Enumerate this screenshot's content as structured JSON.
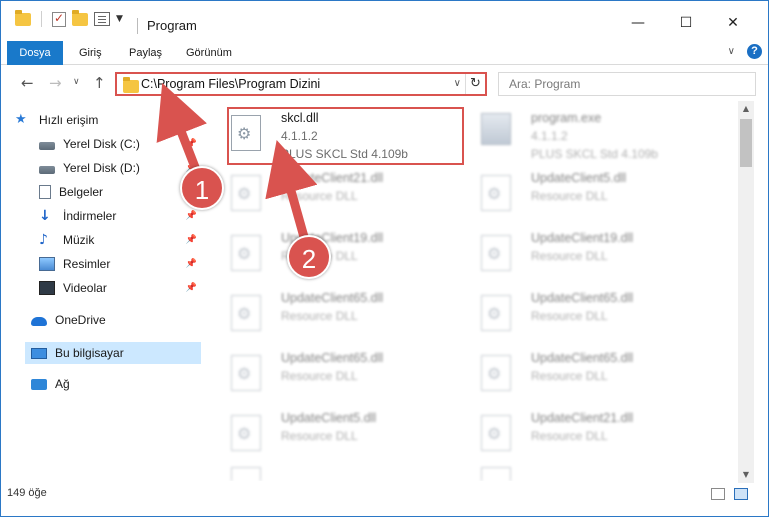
{
  "window": {
    "title": "Program"
  },
  "ribbon": {
    "tabs": [
      "Dosya",
      "Giriş",
      "Paylaş",
      "Görünüm"
    ]
  },
  "navigation": {
    "address": "C:\\Program Files\\Program Dizini",
    "search_placeholder": "Ara: Program"
  },
  "sidebar": {
    "items": [
      {
        "label": "Hızlı erişim",
        "icon": "star-icon"
      },
      {
        "label": "Yerel Disk (C:)",
        "icon": "drive-icon",
        "pinned": true
      },
      {
        "label": "Yerel Disk (D:)",
        "icon": "drive-icon",
        "pinned": true
      },
      {
        "label": "Belgeler",
        "icon": "document-icon",
        "pinned": true
      },
      {
        "label": "İndirmeler",
        "icon": "download-icon",
        "pinned": true
      },
      {
        "label": "Müzik",
        "icon": "music-icon",
        "pinned": true
      },
      {
        "label": "Resimler",
        "icon": "pictures-icon",
        "pinned": true
      },
      {
        "label": "Videolar",
        "icon": "video-icon",
        "pinned": true
      },
      {
        "label": "OneDrive",
        "icon": "cloud-icon"
      },
      {
        "label": "Bu bilgisayar",
        "icon": "computer-icon",
        "selected": true
      },
      {
        "label": "Ağ",
        "icon": "network-icon"
      }
    ]
  },
  "files": [
    {
      "name": "skcl.dll",
      "line2": "4.1.1.2",
      "line3": "PLUS SKCL Std 4.109b",
      "highlighted": true
    },
    {
      "name": "program.exe",
      "line2": "4.1.1.2",
      "line3": "PLUS SKCL Std 4.109b"
    },
    {
      "name": "UpdateClient21.dll",
      "line2": "Resource DLL"
    },
    {
      "name": "UpdateClient5.dll",
      "line2": "Resource DLL"
    },
    {
      "name": "UpdateClient19.dll",
      "line2": "Resource DLL"
    },
    {
      "name": "UpdateClient19.dll",
      "line2": "Resource DLL"
    },
    {
      "name": "UpdateClient65.dll",
      "line2": "Resource DLL"
    },
    {
      "name": "UpdateClient65.dll",
      "line2": "Resource DLL"
    },
    {
      "name": "UpdateClient65.dll",
      "line2": "Resource DLL"
    },
    {
      "name": "UpdateClient65.dll",
      "line2": "Resource DLL"
    },
    {
      "name": "UpdateClient5.dll",
      "line2": "Resource DLL"
    },
    {
      "name": "UpdateClient21.dll",
      "line2": "Resource DLL"
    }
  ],
  "status": {
    "item_count": "149 öğe"
  },
  "annotations": {
    "step1": "1",
    "step2": "2",
    "color": "#d9534f"
  }
}
